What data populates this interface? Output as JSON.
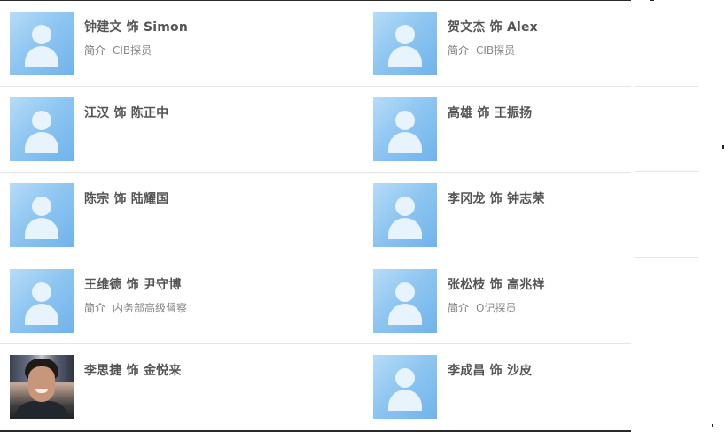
{
  "cast": [
    [
      {
        "name": "钟建文 饰 Simon",
        "intro_label": "简介",
        "intro": "CIB探员",
        "avatar": "placeholder-avatar-icon"
      },
      {
        "name": "贺文杰 饰 Alex",
        "intro_label": "简介",
        "intro": "CIB探员",
        "avatar": "placeholder-avatar-icon"
      }
    ],
    [
      {
        "name": "江汉 饰 陈正中",
        "intro_label": "",
        "intro": "",
        "avatar": "placeholder-avatar-icon"
      },
      {
        "name": "高雄 饰 王振扬",
        "intro_label": "",
        "intro": "",
        "avatar": "placeholder-avatar-icon"
      }
    ],
    [
      {
        "name": "陈宗 饰 陆耀国",
        "intro_label": "",
        "intro": "",
        "avatar": "placeholder-avatar-icon"
      },
      {
        "name": "李冈龙 饰 钟志荣",
        "intro_label": "",
        "intro": "",
        "avatar": "placeholder-avatar-icon"
      }
    ],
    [
      {
        "name": "王维德 饰 尹守博",
        "intro_label": "简介",
        "intro": "内务部高级督察",
        "avatar": "placeholder-avatar-icon"
      },
      {
        "name": "张松枝 饰 高兆祥",
        "intro_label": "简介",
        "intro": "O记探员",
        "avatar": "placeholder-avatar-icon"
      }
    ],
    [
      {
        "name": "李思捷 饰 金悦来",
        "intro_label": "",
        "intro": "",
        "avatar": "actor-photo"
      },
      {
        "name": "李成昌 饰 沙皮",
        "intro_label": "",
        "intro": "",
        "avatar": "placeholder-avatar-icon"
      }
    ]
  ],
  "colors": {
    "placeholder_gradient_start": "#b7dcf7",
    "placeholder_gradient_end": "#70b3ec",
    "name_text": "#555555",
    "intro_text": "#888888",
    "divider": "#e6e6e6"
  }
}
